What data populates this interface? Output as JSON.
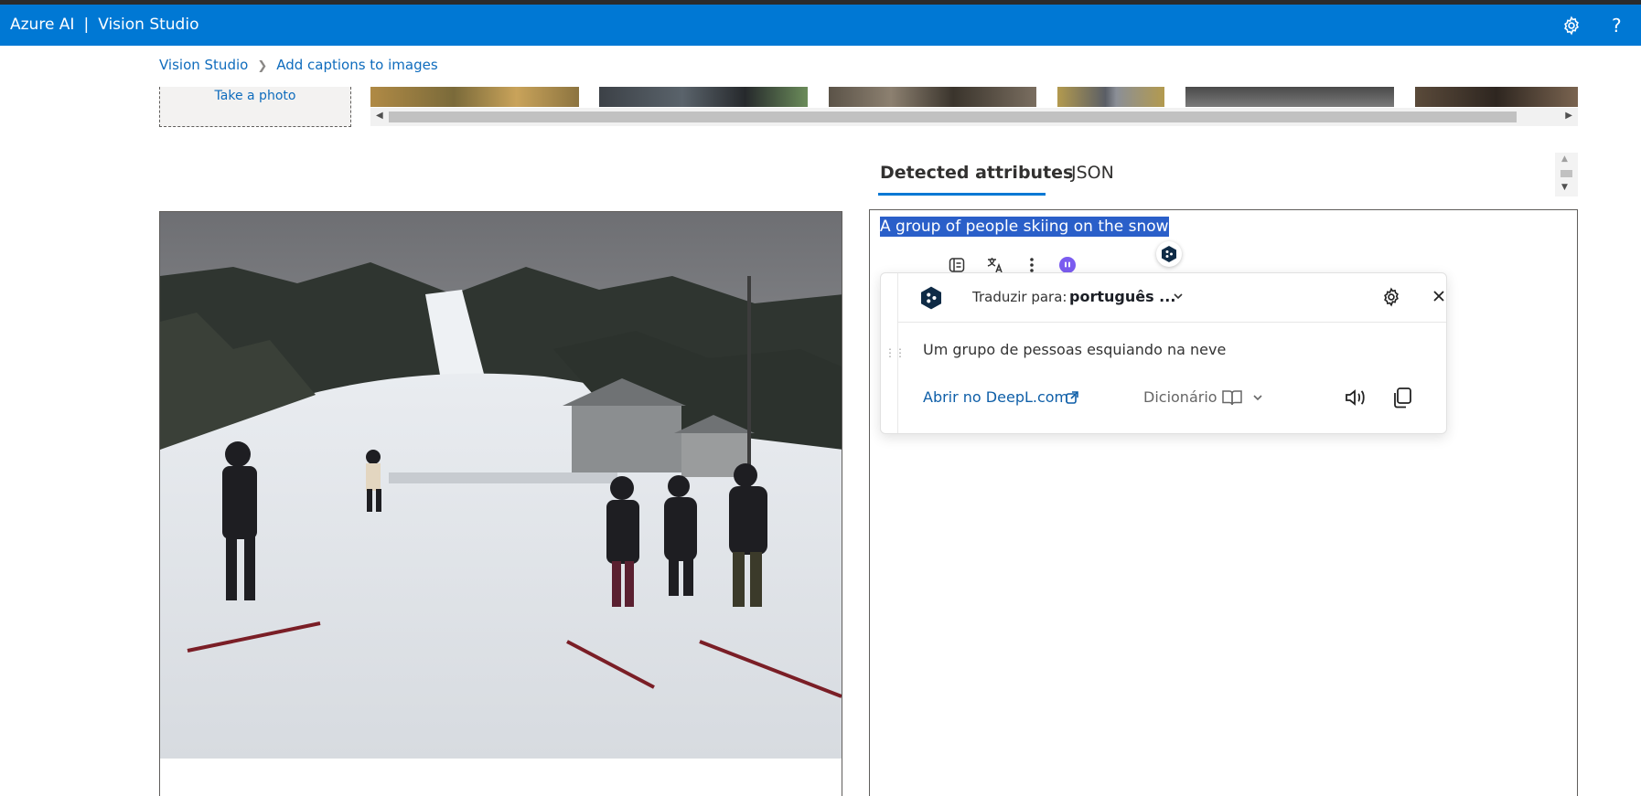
{
  "app": {
    "brand": "Azure AI",
    "product": "Vision Studio",
    "bar_color": "#0078d4"
  },
  "breadcrumb": {
    "items": [
      "Vision Studio",
      "Add captions to images"
    ]
  },
  "upload": {
    "take_photo": "Take a photo"
  },
  "tabs": [
    {
      "label": "Detected attributes",
      "active": true
    },
    {
      "label": "JSON",
      "active": false
    }
  ],
  "result": {
    "caption": "A group of people skiing on the snow"
  },
  "deepl": {
    "translate_to_label": "Traduzir para:",
    "target_language": "português ...",
    "translation": "Um grupo de pessoas esquiando na neve",
    "open_link": "Abrir no DeepL.com",
    "dictionary": "Dicionário",
    "brand_color": "#0f2b46"
  },
  "icons": [
    "settings-icon",
    "help-icon",
    "chevron-right-icon",
    "deepl-logo-icon",
    "close-icon",
    "external-link-icon",
    "book-icon",
    "speaker-icon",
    "copy-icon"
  ]
}
